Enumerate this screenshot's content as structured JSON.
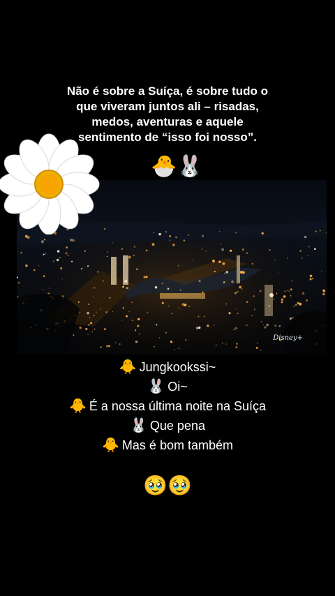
{
  "caption": {
    "lines": [
      "Não é sobre a Suíça, é sobre tudo o",
      "que viveram juntos ali – risadas,",
      "medos, aventuras e aquele",
      "sentimento de “isso foi nosso”."
    ],
    "stickers": "🐣🐰"
  },
  "photo": {
    "watermark": "Disney+"
  },
  "chat": [
    {
      "emoji": "🐥",
      "text": "Jungkookssi~"
    },
    {
      "emoji": "🐰",
      "text": "Oi~"
    },
    {
      "emoji": "🐥",
      "text": "É a nossa última noite na Suíça"
    },
    {
      "emoji": "🐰",
      "text": "Que pena"
    },
    {
      "emoji": "🐥",
      "text": "Mas é bom também"
    }
  ],
  "reaction": "🥹🥹",
  "colors": {
    "background": "#000000",
    "text": "#ffffff",
    "daisy_center": "#f5a300",
    "daisy_petals": "#ffffff",
    "city_lights": "#ffb24a"
  }
}
